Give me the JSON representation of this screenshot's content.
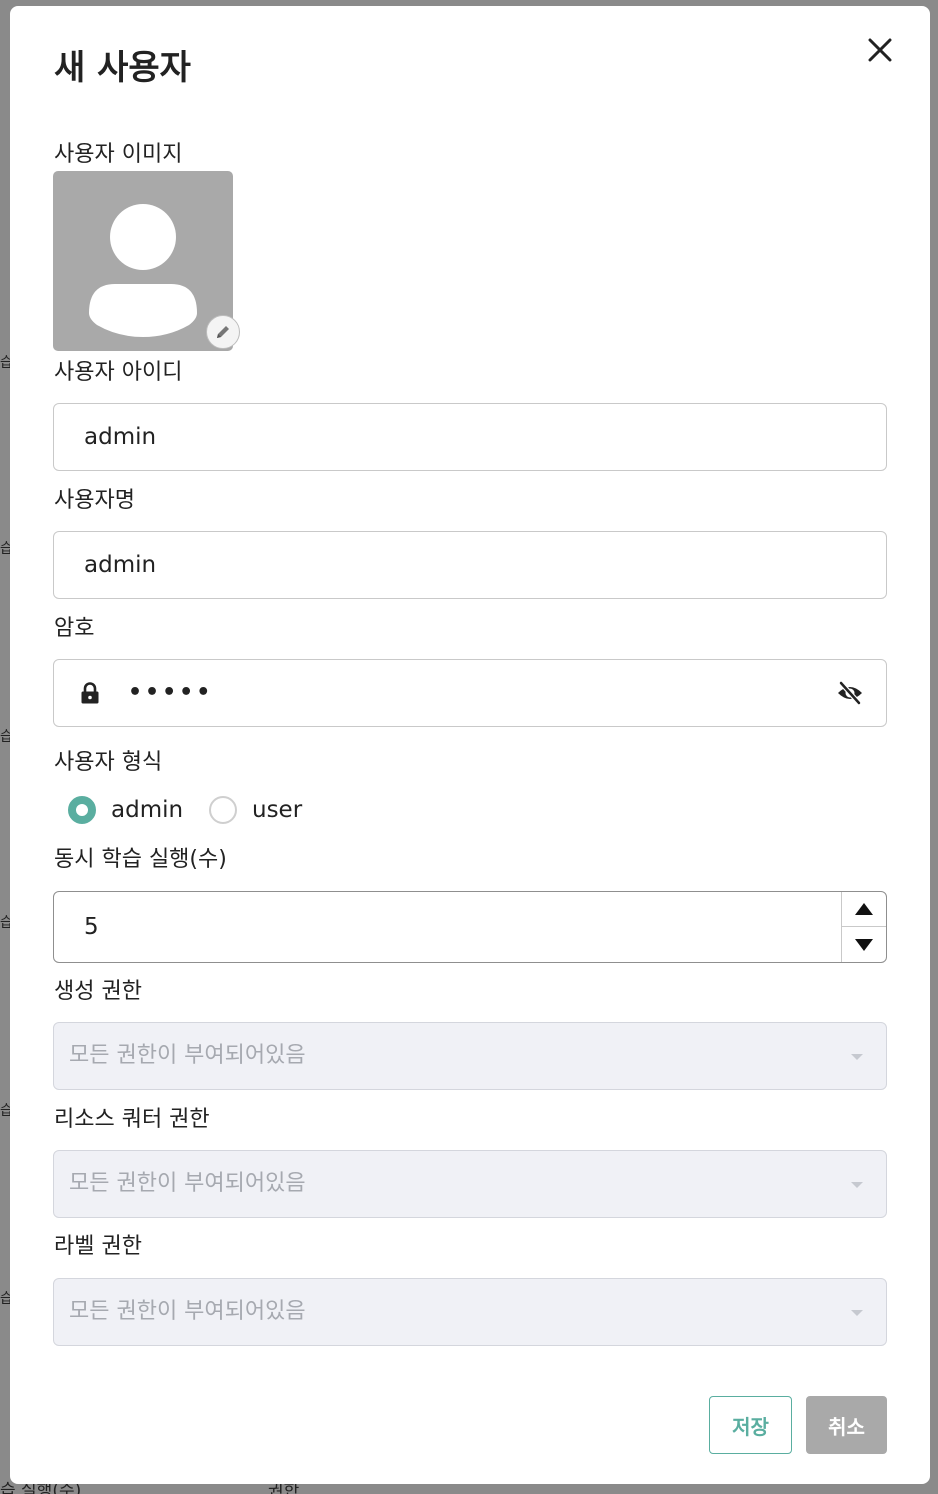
{
  "background": {
    "row_fragments": [
      "습",
      "습",
      "습",
      "습",
      "습",
      "습",
      "습"
    ],
    "bottom_left": "습 실행(수)",
    "bottom_mid": "권한"
  },
  "dialog": {
    "title": "새 사용자",
    "close_icon": "close-icon",
    "image_label": "사용자 이미지",
    "user_id": {
      "label": "사용자 아이디",
      "value": "admin"
    },
    "user_name": {
      "label": "사용자명",
      "value": "admin"
    },
    "password": {
      "label": "암호",
      "masked_value": "•••••"
    },
    "user_type": {
      "label": "사용자 형식",
      "options": [
        {
          "label": "admin",
          "selected": true
        },
        {
          "label": "user",
          "selected": false
        }
      ]
    },
    "concurrent_runs": {
      "label": "동시 학습 실행(수)",
      "value": "5"
    },
    "create_permission": {
      "label": "생성 권한",
      "placeholder": "모든 권한이 부여되어있음"
    },
    "resource_quota_permission": {
      "label": "리소스 쿼터 권한",
      "placeholder": "모든 권한이 부여되어있음"
    },
    "label_permission": {
      "label": "라벨 권한",
      "placeholder": "모든 권한이 부여되어있음"
    },
    "save_label": "저장",
    "cancel_label": "취소"
  },
  "colors": {
    "accent": "#5aaea0",
    "disabled_button": "#a9a9a9",
    "avatar_bg": "#a9a9a9",
    "select_bg": "#f0f1f6"
  }
}
